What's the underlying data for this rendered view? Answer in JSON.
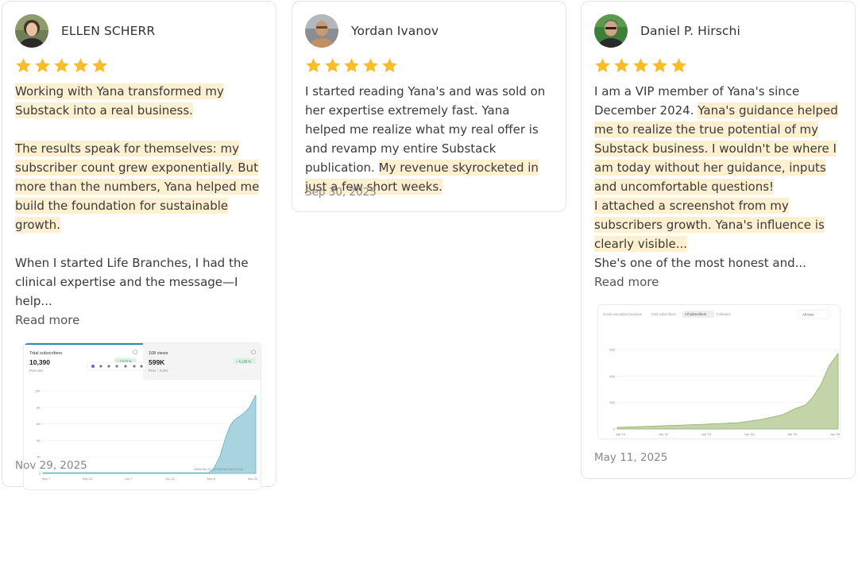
{
  "reviews": [
    {
      "name": "ELLEN SCHERR",
      "rating": 5,
      "paragraphs": [
        {
          "text": "Working with Yana transformed my Substack into a real business."
        },
        {
          "text": "The results speak for themselves: my subscriber count grew exponentially. But more than the numbers, Yana helped me build the foundation for sustainable growth."
        },
        {
          "text": "When I started Life Branches, I had the clinical expertise and the message—I help..."
        }
      ],
      "read_more": "Read more",
      "date": "Nov 29, 2025",
      "screenshot": {
        "tab1_label": "Total subscribers",
        "tab1_value": "10,390",
        "tab1_sub": "Prev 5%",
        "tab1_badge": "↑ 2,023 %",
        "tab2_label": "108 views",
        "tab2_value": "599K",
        "tab2_sub": "Prev ↑ 0.3%",
        "tab2_badge": "↑ 4,136 %",
        "yticks": [
          "10K",
          "8K",
          "6K",
          "4K",
          "2K",
          "0"
        ],
        "xticks": [
          "Sep 7",
          "Sep 22",
          "Oct 7",
          "Oct 22",
          "Nov 6",
          "Nov 21"
        ],
        "watermark": "WWW.BLOG.LIFEBRANCHES.COM"
      }
    },
    {
      "name": "Yordan Ivanov",
      "rating": 5,
      "text_plain": "I started reading Yana's and was sold on her expertise extremely fast. Yana helped me realize what my real offer is and revamp my entire Substack publication.",
      "text_mark": "My revenue skyrocketed in just a few short weeks.",
      "date": "Sep 30, 2025"
    },
    {
      "name": "Daniel P. Hirschi",
      "rating": 5,
      "text_plain": "I am a VIP member of Yana's since December 2024.",
      "text_mark1": "Yana's guidance helped me to realize the true potential of my Substack business. I wouldn't be where I am today without her guidance, inputs and uncomfortable questions!",
      "text_mark2": "I attached a screenshot from my subscribers growth. Yana's influence is clearly visible...",
      "text_tail": "She's one of the most honest and...",
      "read_more": "Read more",
      "date": "May 11, 2025",
      "screenshot": {
        "tabs": [
          "Gross annualized revenue",
          "Paid subscribers",
          "All subscribers",
          "Followers"
        ],
        "range": "All time",
        "yticks": [
          "600",
          "400",
          "200",
          "0"
        ],
        "xticks": [
          "Jan '21",
          "Jan '22",
          "Jan '23",
          "Jan '24",
          "Jan '25",
          "Jan '26"
        ]
      }
    }
  ],
  "colors": {
    "star": "#fbbc2a",
    "highlight": "#fdf0d0",
    "chart1_fill": "#a9d3df",
    "chart2_fill": "#c3d5a8"
  }
}
